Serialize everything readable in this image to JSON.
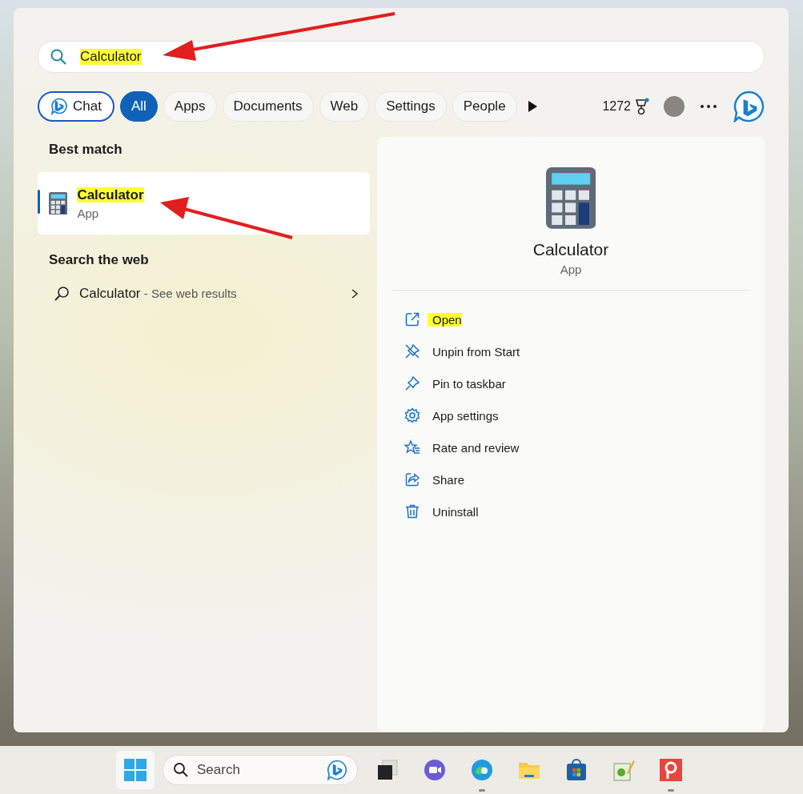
{
  "search": {
    "value": "Calculator",
    "highlighted": true
  },
  "filters": [
    {
      "label": "Chat",
      "kind": "chat",
      "selected": false
    },
    {
      "label": "All",
      "kind": "plain",
      "selected": true
    },
    {
      "label": "Apps",
      "kind": "plain",
      "selected": false
    },
    {
      "label": "Documents",
      "kind": "plain",
      "selected": false
    },
    {
      "label": "Web",
      "kind": "plain",
      "selected": false
    },
    {
      "label": "Settings",
      "kind": "plain",
      "selected": false
    },
    {
      "label": "People",
      "kind": "plain",
      "selected": false
    }
  ],
  "rewards_points": "1272",
  "best_match": {
    "heading": "Best match",
    "title": "Calculator",
    "subtitle": "App",
    "selected": true,
    "highlighted": true
  },
  "web": {
    "heading": "Search the web",
    "query": "Calculator",
    "hint": " - See web results"
  },
  "details": {
    "title": "Calculator",
    "subtitle": "App",
    "actions": [
      {
        "label": "Open",
        "kind": "open",
        "highlighted": true
      },
      {
        "label": "Unpin from Start",
        "kind": "unpin",
        "highlighted": false
      },
      {
        "label": "Pin to taskbar",
        "kind": "pin",
        "highlighted": false
      },
      {
        "label": "App settings",
        "kind": "settings",
        "highlighted": false
      },
      {
        "label": "Rate and review",
        "kind": "rate",
        "highlighted": false
      },
      {
        "label": "Share",
        "kind": "share",
        "highlighted": false
      },
      {
        "label": "Uninstall",
        "kind": "uninstall",
        "highlighted": false
      }
    ]
  },
  "taskbar": {
    "search_placeholder": "Search",
    "apps": [
      {
        "kind": "windows",
        "running": false
      },
      {
        "kind": "meet",
        "running": false
      },
      {
        "kind": "browser",
        "running": true
      },
      {
        "kind": "folder",
        "running": false
      },
      {
        "kind": "store",
        "running": false
      },
      {
        "kind": "notes",
        "running": false
      },
      {
        "kind": "pin",
        "running": true
      }
    ]
  }
}
